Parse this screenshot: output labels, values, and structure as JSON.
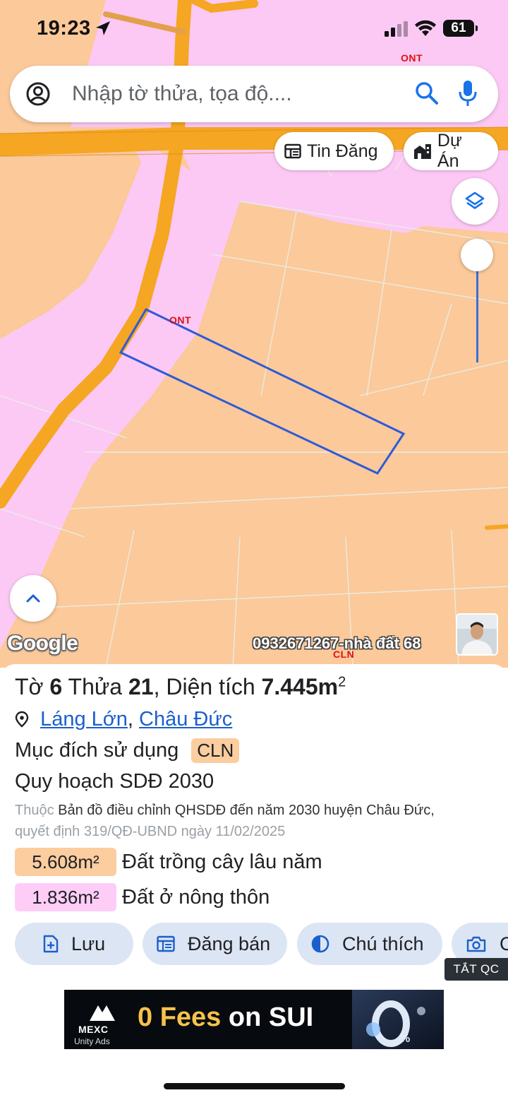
{
  "status_bar": {
    "time": "19:23",
    "battery": "61"
  },
  "search": {
    "placeholder": "Nhập tờ thửa, tọa độ...."
  },
  "map": {
    "chips": {
      "tin_dang": "Tin Đăng",
      "du_an": "Dự Án"
    },
    "labels": {
      "ont_top": "ONT",
      "ont_parcel": "ONT",
      "cln_bottom": "CLN"
    },
    "google_logo": "Google",
    "watermark": "0932671267-nhà đất 68"
  },
  "parcel": {
    "title": {
      "prefix": "Tờ",
      "sheet": "6",
      "lot_label": "Thửa",
      "lot": "21",
      "area_label": "Diện tích",
      "area": "7.445m",
      "unit_sup": "2"
    },
    "location": {
      "commune": "Láng Lớn",
      "district": "Châu Đức"
    },
    "purpose_label": "Mục đích sử dụng",
    "purpose_code": "CLN",
    "plan_title": "Quy hoạch SDĐ 2030",
    "note": {
      "prefix": "Thuộc",
      "line1": "Bản đồ điều chỉnh QHSDĐ đến năm 2030 huyện Châu Đức,",
      "line2": "quyết định 319/QĐ-UBND ngày 11/02/2025"
    },
    "areas": [
      {
        "value": "5.608m²",
        "label": "Đất trồng cây lâu năm",
        "color": "#fbcd9f"
      },
      {
        "value": "1.836m²",
        "label": "Đất ở nông thôn",
        "color": "#fdcdf7"
      }
    ]
  },
  "actions": {
    "save": "Lưu",
    "sell": "Đăng bán",
    "legend": "Chú thích",
    "capture": "C"
  },
  "ad": {
    "close_label": "TẮT QC",
    "brand": "MEXC",
    "network": "Unity Ads",
    "headline_a": "0 Fees",
    "headline_b": "on SUI"
  },
  "colors": {
    "cln_fill": "#fbc99a",
    "ont_fill": "#fcc9f5",
    "road": "#f5a623",
    "parcel_outline": "#2d5bd8",
    "accent": "#1a73e8"
  }
}
